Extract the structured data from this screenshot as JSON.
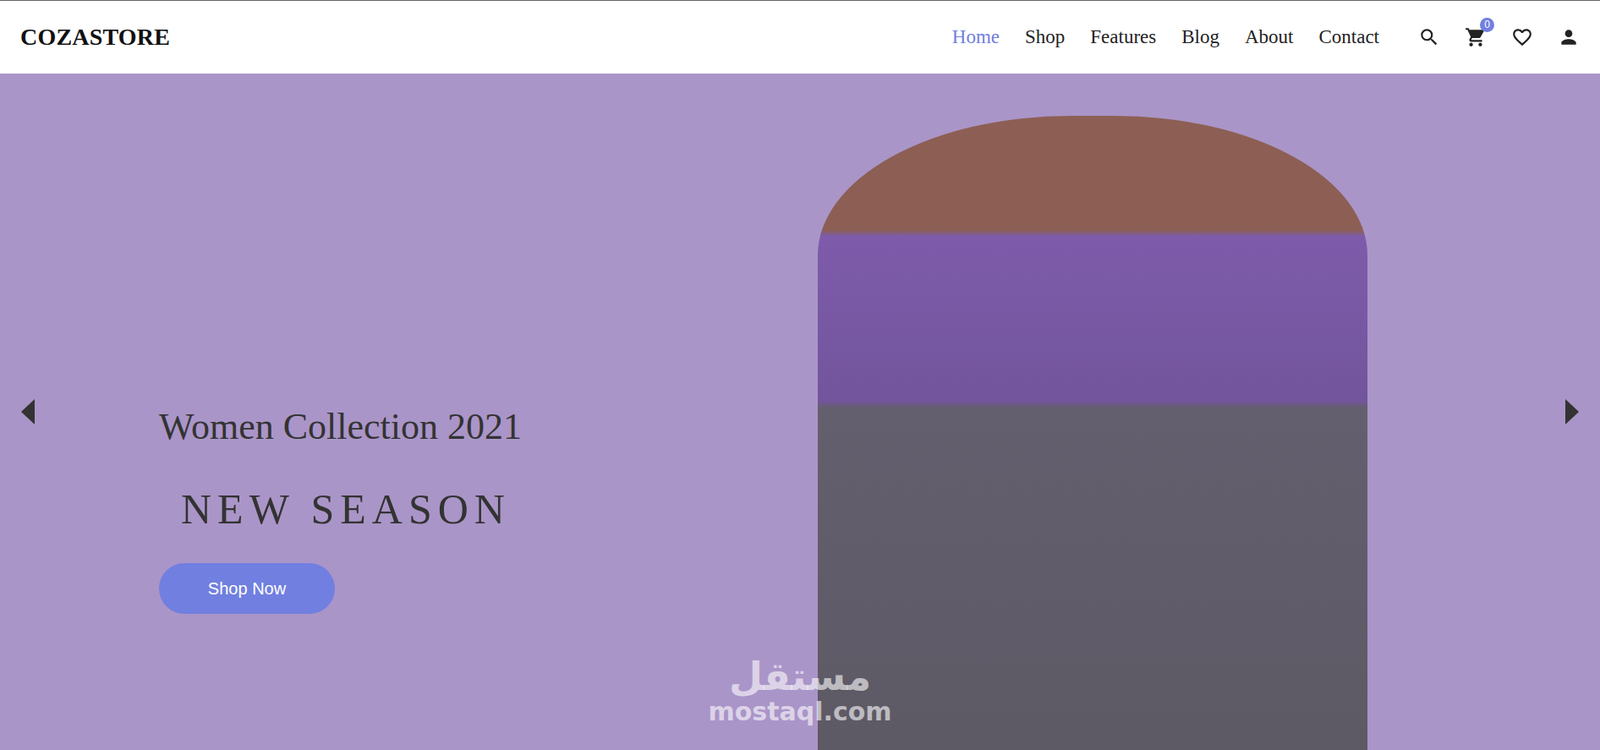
{
  "logo": "COZASTORE",
  "nav": [
    {
      "label": "Home",
      "selected": true
    },
    {
      "label": "Shop",
      "selected": false
    },
    {
      "label": "Features",
      "selected": false
    },
    {
      "label": "Blog",
      "selected": false
    },
    {
      "label": "About",
      "selected": false
    },
    {
      "label": "Contact",
      "selected": false
    }
  ],
  "cart": {
    "count": "0"
  },
  "hero": {
    "title": "Women Collection 2021",
    "subtitle": "NEW SEASON",
    "button": "Shop Now"
  },
  "watermark": {
    "arabic": "مستقل",
    "latin": "mostaql.com"
  }
}
